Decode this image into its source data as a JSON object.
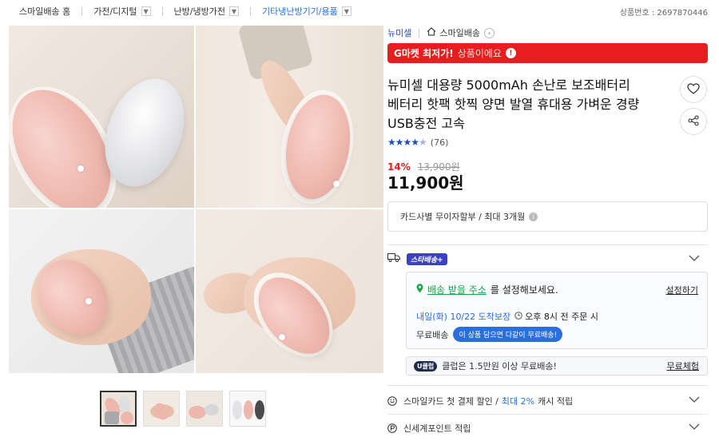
{
  "breadcrumb": {
    "items": [
      "스마일배송 홈",
      "가전/디지털",
      "난방/냉방가전",
      "기타냉난방기기/용품"
    ],
    "active_index": 3
  },
  "product_number": "상품번호 : 2697870446",
  "seller": {
    "shop_name": "뉴미셀",
    "delivery_label": "스마일배송"
  },
  "banner": {
    "highlight": "G마켓 최저가!",
    "text": "상품이에요"
  },
  "product": {
    "title": "뉴미셀 대용량 5000mAh 손난로 보조배터리 베터리 핫팩 핫찍 양면 발열 휴대용 가벼운 경량 USB충전 고속",
    "rating_stars": 4.5,
    "review_count": "(76)",
    "discount_percent": "14%",
    "original_price": "13,900원",
    "price": "11,900원"
  },
  "payment": {
    "card_text": "카드사별 무이자할부 / 최대 3개월"
  },
  "delivery": {
    "badge": "스타배송+",
    "address_link": "배송 받을 주소",
    "address_suffix": "를 설정해보세요.",
    "set_link": "설정하기",
    "eta_blue": "내일(화) 10/22 도착보장",
    "eta_rest": "오후 8시 전 주문 시",
    "free_label": "무료배송",
    "free_bubble": "이 상품 담으면 다같이 무료배송!"
  },
  "club": {
    "badge": "U클럽",
    "text": "클럽은 1.5만원 이상 무료배송!",
    "link": "무료체험"
  },
  "benefits": {
    "smilecard_prefix": "스마일카드 첫 결제 할인 /",
    "smilecard_blue": "최대 2%",
    "smilecard_suffix": "캐시 적립",
    "shinsegae": "신세계포인트 적립"
  },
  "colors": {
    "accent_blue": "#2a6fdb",
    "banner_red": "#e81d1d",
    "badge_purple": "#3b40c4",
    "address_green": "#1aa64b"
  }
}
